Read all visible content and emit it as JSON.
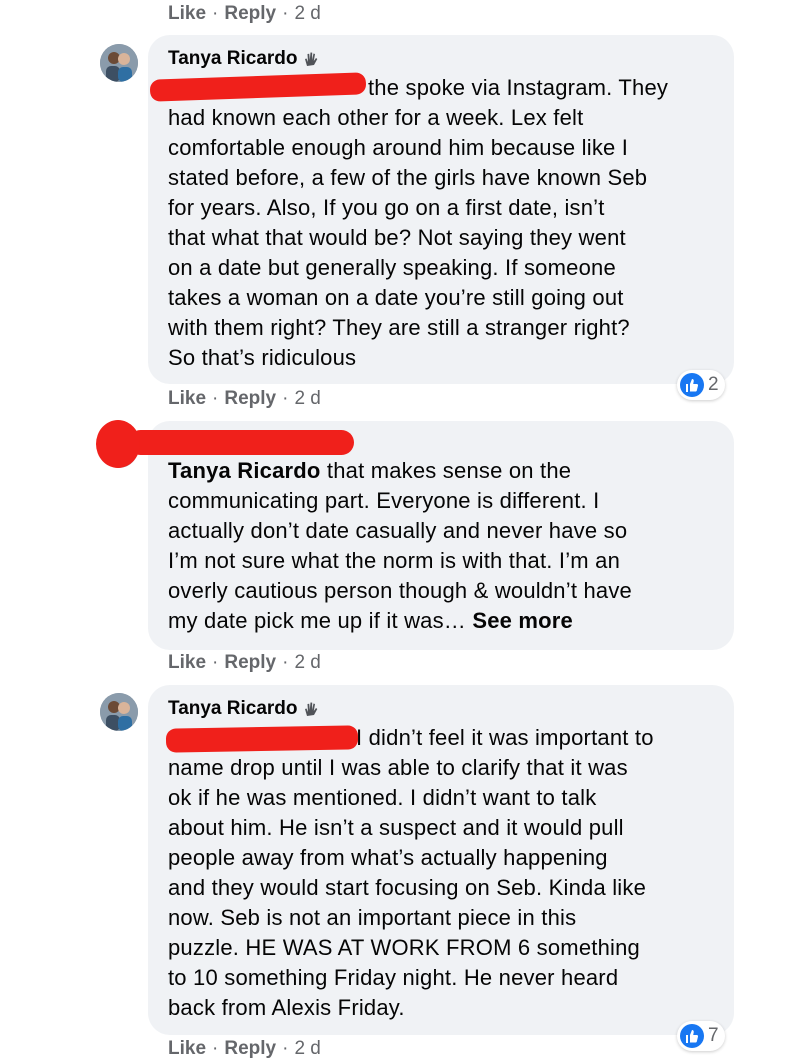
{
  "colors": {
    "bubble": "#f0f2f5",
    "meta": "#65676b",
    "like_blue": "#1877f2",
    "redaction": "#f0201b"
  },
  "comments": [
    {
      "actions": {
        "like": "Like",
        "reply": "Reply",
        "sep": "·",
        "time": "2 d"
      }
    },
    {
      "author": "Tanya Ricardo",
      "author_icon": "hand-wave-icon",
      "lines": [
        "the spoke via Instagram. They",
        "had known each other for a week. Lex felt",
        "comfortable enough around him because like I",
        "stated before, a few of the girls have known Seb",
        "for years. Also, If you go on a first date, isn’t",
        "that what that would be? Not saying they went",
        "on a date but generally speaking. If someone",
        "takes a woman on a date you’re still going out",
        "with them right? They are still a stranger right?",
        "So that’s ridiculous"
      ],
      "reactions": {
        "icon": "thumbs-up-icon",
        "count": "2"
      },
      "actions": {
        "like": "Like",
        "reply": "Reply",
        "sep": "·",
        "time": "2 d"
      }
    },
    {
      "mention": "Tanya Ricardo",
      "first_line_rest": " that makes sense on the",
      "lines": [
        "communicating part. Everyone is different. I",
        "actually don’t date casually and never have so",
        "I’m not sure what the norm is with that. I’m an",
        "overly cautious person though & wouldn’t have"
      ],
      "last_line": "my date pick me up if it was…",
      "see_more": "See more",
      "actions": {
        "like": "Like",
        "reply": "Reply",
        "sep": "·",
        "time": "2 d"
      }
    },
    {
      "author": "Tanya Ricardo",
      "author_icon": "hand-wave-icon",
      "lines": [
        " I didn’t feel it was important to",
        "name drop until I was able to clarify that it was",
        "ok if he was mentioned. I didn’t want to talk",
        "about him. He isn’t a suspect and it would pull",
        "people away from what’s actually happening",
        "and they would start focusing on Seb. Kinda like",
        "now. Seb is not an important piece in this",
        "puzzle. HE WAS AT WORK FROM 6 something",
        "to 10 something Friday night. He never heard",
        "back from Alexis Friday."
      ],
      "reactions": {
        "icon": "thumbs-up-icon",
        "count": "7"
      },
      "actions": {
        "like": "Like",
        "reply": "Reply",
        "sep": "·",
        "time": "2 d"
      }
    }
  ]
}
